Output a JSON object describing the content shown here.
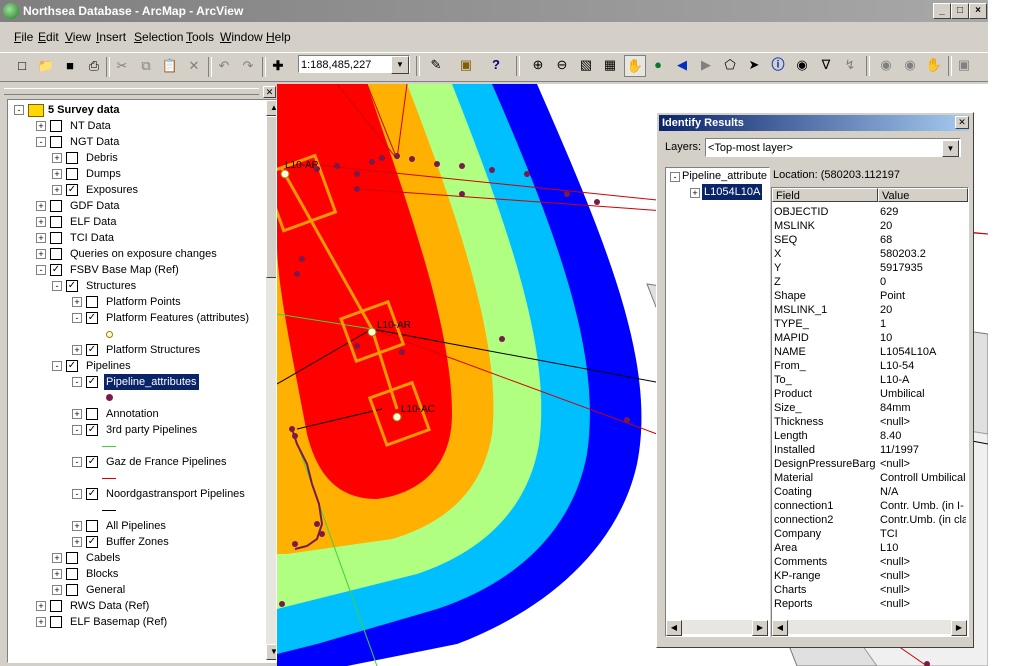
{
  "window": {
    "title": "Northsea Database - ArcMap - ArcView",
    "controls": [
      "_",
      "□",
      "×"
    ]
  },
  "menu": [
    {
      "pre": "",
      "u": "F",
      "post": "ile"
    },
    {
      "pre": "",
      "u": "E",
      "post": "dit"
    },
    {
      "pre": "",
      "u": "V",
      "post": "iew"
    },
    {
      "pre": "",
      "u": "I",
      "post": "nsert"
    },
    {
      "pre": "",
      "u": "S",
      "post": "election"
    },
    {
      "pre": "",
      "u": "T",
      "post": "ools"
    },
    {
      "pre": "",
      "u": "W",
      "post": "indow"
    },
    {
      "pre": "",
      "u": "H",
      "post": "elp"
    }
  ],
  "toolbar": {
    "scale": "1:188,485,227"
  },
  "toc": {
    "root_label": "5 Survey data",
    "items": [
      {
        "label": "NT Data",
        "level": 1,
        "expander": "+",
        "checked": false
      },
      {
        "label": "NGT Data",
        "level": 1,
        "expander": "-",
        "checked": false
      },
      {
        "label": "Debris",
        "level": 2,
        "expander": "+",
        "checked": false
      },
      {
        "label": "Dumps",
        "level": 2,
        "expander": "+",
        "checked": false
      },
      {
        "label": "Exposures",
        "level": 2,
        "expander": "+",
        "checked": true
      },
      {
        "label": "GDF Data",
        "level": 1,
        "expander": "+",
        "checked": false
      },
      {
        "label": "ELF Data",
        "level": 1,
        "expander": "+",
        "checked": false
      },
      {
        "label": "TCI Data",
        "level": 1,
        "expander": "+",
        "checked": false
      },
      {
        "label": "Queries on exposure changes",
        "level": 1,
        "expander": "+",
        "checked": false
      },
      {
        "label": "FSBV Base Map (Ref)",
        "level": 1,
        "expander": "-",
        "checked": true
      },
      {
        "label": "Structures",
        "level": 2,
        "expander": "-",
        "checked": true
      },
      {
        "label": "Platform Points",
        "level": 3,
        "expander": "+",
        "checked": false
      },
      {
        "label": "Platform Features (attributes)",
        "level": 3,
        "expander": "-",
        "checked": true
      },
      {
        "label": "",
        "level": 4,
        "symbol": "platform-point"
      },
      {
        "label": "Platform Structures",
        "level": 3,
        "expander": "+",
        "checked": true
      },
      {
        "label": "Pipelines",
        "level": 2,
        "expander": "-",
        "checked": true
      },
      {
        "label": "Pipeline_attributes",
        "level": 3,
        "expander": "-",
        "checked": true,
        "selected": true
      },
      {
        "label": "",
        "level": 4,
        "symbol": "purple-dot"
      },
      {
        "label": "Annotation",
        "level": 3,
        "expander": "+",
        "checked": false
      },
      {
        "label": "3rd party Pipelines",
        "level": 3,
        "expander": "-",
        "checked": true
      },
      {
        "label": "",
        "level": 4,
        "symbol": "green-line"
      },
      {
        "label": "Gaz de France Pipelines",
        "level": 3,
        "expander": "-",
        "checked": true
      },
      {
        "label": "",
        "level": 4,
        "symbol": "red-line"
      },
      {
        "label": "Noordgastransport Pipelines",
        "level": 3,
        "expander": "-",
        "checked": true
      },
      {
        "label": "",
        "level": 4,
        "symbol": "black-line"
      },
      {
        "label": "All Pipelines",
        "level": 3,
        "expander": "+",
        "checked": false
      },
      {
        "label": "Buffer Zones",
        "level": 3,
        "expander": "+",
        "checked": true
      },
      {
        "label": "Cabels",
        "level": 2,
        "expander": "+",
        "checked": false
      },
      {
        "label": "Blocks",
        "level": 2,
        "expander": "+",
        "checked": false
      },
      {
        "label": "General",
        "level": 2,
        "expander": "+",
        "checked": false
      },
      {
        "label": "RWS Data (Ref)",
        "level": 1,
        "expander": "+",
        "checked": false
      },
      {
        "label": "ELF Basemap (Ref)",
        "level": 1,
        "expander": "+",
        "checked": false
      }
    ]
  },
  "map": {
    "labels": [
      "L10-AP",
      "L10-AR",
      "L10-AC"
    ],
    "colors": {
      "buffer_blue": "#0000ff",
      "buffer_lightblue": "#00bfff",
      "buffer_green": "#b0ff80",
      "buffer_orange": "#ffb000",
      "buffer_red": "#ff0000",
      "platform": "#ff9900",
      "pipeline_point": "#7a1a4a"
    }
  },
  "identify": {
    "title": "Identify Results",
    "layers_label": "Layers:",
    "layers_value": "<Top-most layer>",
    "tree_root": "Pipeline_attribute",
    "tree_child": "L1054L10A",
    "location": "Location: (580203.112197",
    "columns": [
      "Field",
      "Value"
    ],
    "rows": [
      [
        "OBJECTID",
        "629"
      ],
      [
        "MSLINK",
        "20"
      ],
      [
        "SEQ",
        "68"
      ],
      [
        "X",
        "580203.2"
      ],
      [
        "Y",
        "5917935"
      ],
      [
        "Z",
        "0"
      ],
      [
        "Shape",
        "Point"
      ],
      [
        "MSLINK_1",
        "20"
      ],
      [
        "TYPE_",
        "1"
      ],
      [
        "MAPID",
        "10"
      ],
      [
        "NAME",
        "L1054L10A"
      ],
      [
        "From_",
        "L10-54"
      ],
      [
        "To_",
        "L10-A"
      ],
      [
        "Product",
        "Umbilical"
      ],
      [
        "Size_",
        "84mm"
      ],
      [
        "Thickness",
        "<null>"
      ],
      [
        "Length",
        "8.40"
      ],
      [
        "Installed",
        "11/1997"
      ],
      [
        "DesignPressureBarg",
        "<null>"
      ],
      [
        "Material",
        "Controll Umbilical"
      ],
      [
        "Coating",
        "N/A"
      ],
      [
        "connection1",
        "Contr. Umb. (in I-"
      ],
      [
        "connection2",
        "Contr.Umb. (in cla"
      ],
      [
        "Company",
        "TCI"
      ],
      [
        "Area",
        "L10"
      ],
      [
        "Comments",
        "<null>"
      ],
      [
        "KP-range",
        "<null>"
      ],
      [
        "Charts",
        "<null>"
      ],
      [
        "Reports",
        "<null>"
      ]
    ]
  }
}
